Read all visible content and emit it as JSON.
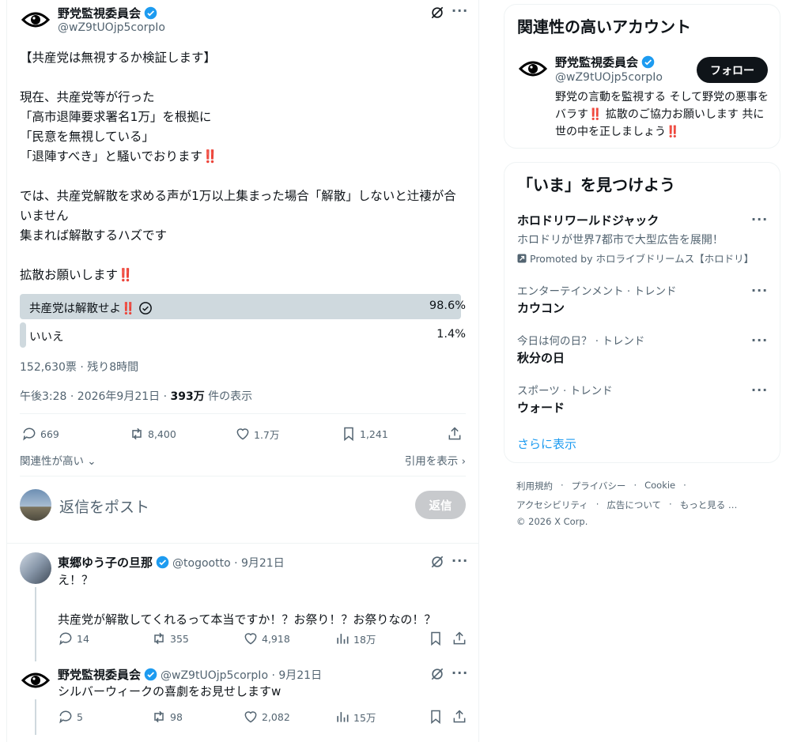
{
  "main_post": {
    "author_name": "野党監視委員会",
    "author_handle": "@wZ9tUOjp5corpIo",
    "text": "【共産党は無視するか検証します】\n\n現在、共産党等が行った\n「高市退陣要求署名1万」を根拠に\n「民意を無視している」\n「退陣すべき」と騒いでおります‼️\n\nでは、共産党解散を求める声が1万以上集まった場合「解散」しないと辻褄が合いません\n集まれば解散するハズです\n\n拡散お願いします‼️",
    "poll": {
      "options": [
        {
          "label": "共産党は解散せよ‼️",
          "percent_text": "98.6%",
          "fraction": 0.986,
          "selected": true
        },
        {
          "label": "いいえ",
          "percent_text": "1.4%",
          "fraction": 0.014,
          "selected": false
        }
      ],
      "summary": "152,630票 · 残り8時間"
    },
    "timestamp": "午後3:28 · 2026年9月21日 · ",
    "views_count": "393万",
    "views_suffix": " 件の表示",
    "actions": {
      "replies": "669",
      "reposts": "8,400",
      "likes": "1.7万",
      "bookmarks": "1,241"
    },
    "sort_label": "関連性が高い",
    "quotes_label": "引用を表示",
    "reply_placeholder": "返信をポスト",
    "reply_button": "返信"
  },
  "replies": [
    {
      "author_name": "東郷ゆう子の旦那",
      "meta": "@togootto · 9月21日",
      "text": "え！？\n\n共産党が解散してくれるって本当ですか！？お祭り！？お祭りなの！？",
      "actions": {
        "replies": "14",
        "reposts": "355",
        "likes": "4,918",
        "views": "18万"
      }
    },
    {
      "author_name": "野党監視委員会",
      "meta": "@wZ9tUOjp5corpIo · 9月21日",
      "text": "シルバーウィークの喜劇をお見せしますw",
      "actions": {
        "replies": "5",
        "reposts": "98",
        "likes": "2,082",
        "views": "15万"
      }
    }
  ],
  "sidebar": {
    "related": {
      "title": "関連性の高いアカウント",
      "name": "野党監視委員会",
      "handle": "@wZ9tUOjp5corpIo",
      "follow_label": "フォロー",
      "bio": "野党の言動を監視する そして野党の悪事をバラす‼️ 拡散のご協力お願いします 共に世の中を正しましょう‼️"
    },
    "trends": {
      "title": "「いま」を見つけよう",
      "promo_name": "ホロドリワールドジャック",
      "promo_desc": "ホロドリが世界7都市で大型広告を展開！",
      "promo_by": "Promoted by ホロライブドリームス【ホロドリ】",
      "items": [
        {
          "meta": "エンターテインメント · トレンド",
          "name": "カウコン"
        },
        {
          "meta": "今日は何の日？ · トレンド",
          "name": "秋分の日"
        },
        {
          "meta": "スポーツ · トレンド",
          "name": "ウォード"
        }
      ],
      "show_more": "さらに表示"
    },
    "footer": {
      "line1": [
        "利用規約",
        "プライバシー",
        "Cookie"
      ],
      "line2": [
        "アクセシビリティ",
        "広告について",
        "もっと見る …"
      ],
      "copyright": "© 2026 X Corp."
    }
  },
  "colors": {
    "accent": "#1d9bf0",
    "poll_fill": "#cfd9de",
    "verified": "#1d9bf0",
    "alert": "#f4212e"
  }
}
